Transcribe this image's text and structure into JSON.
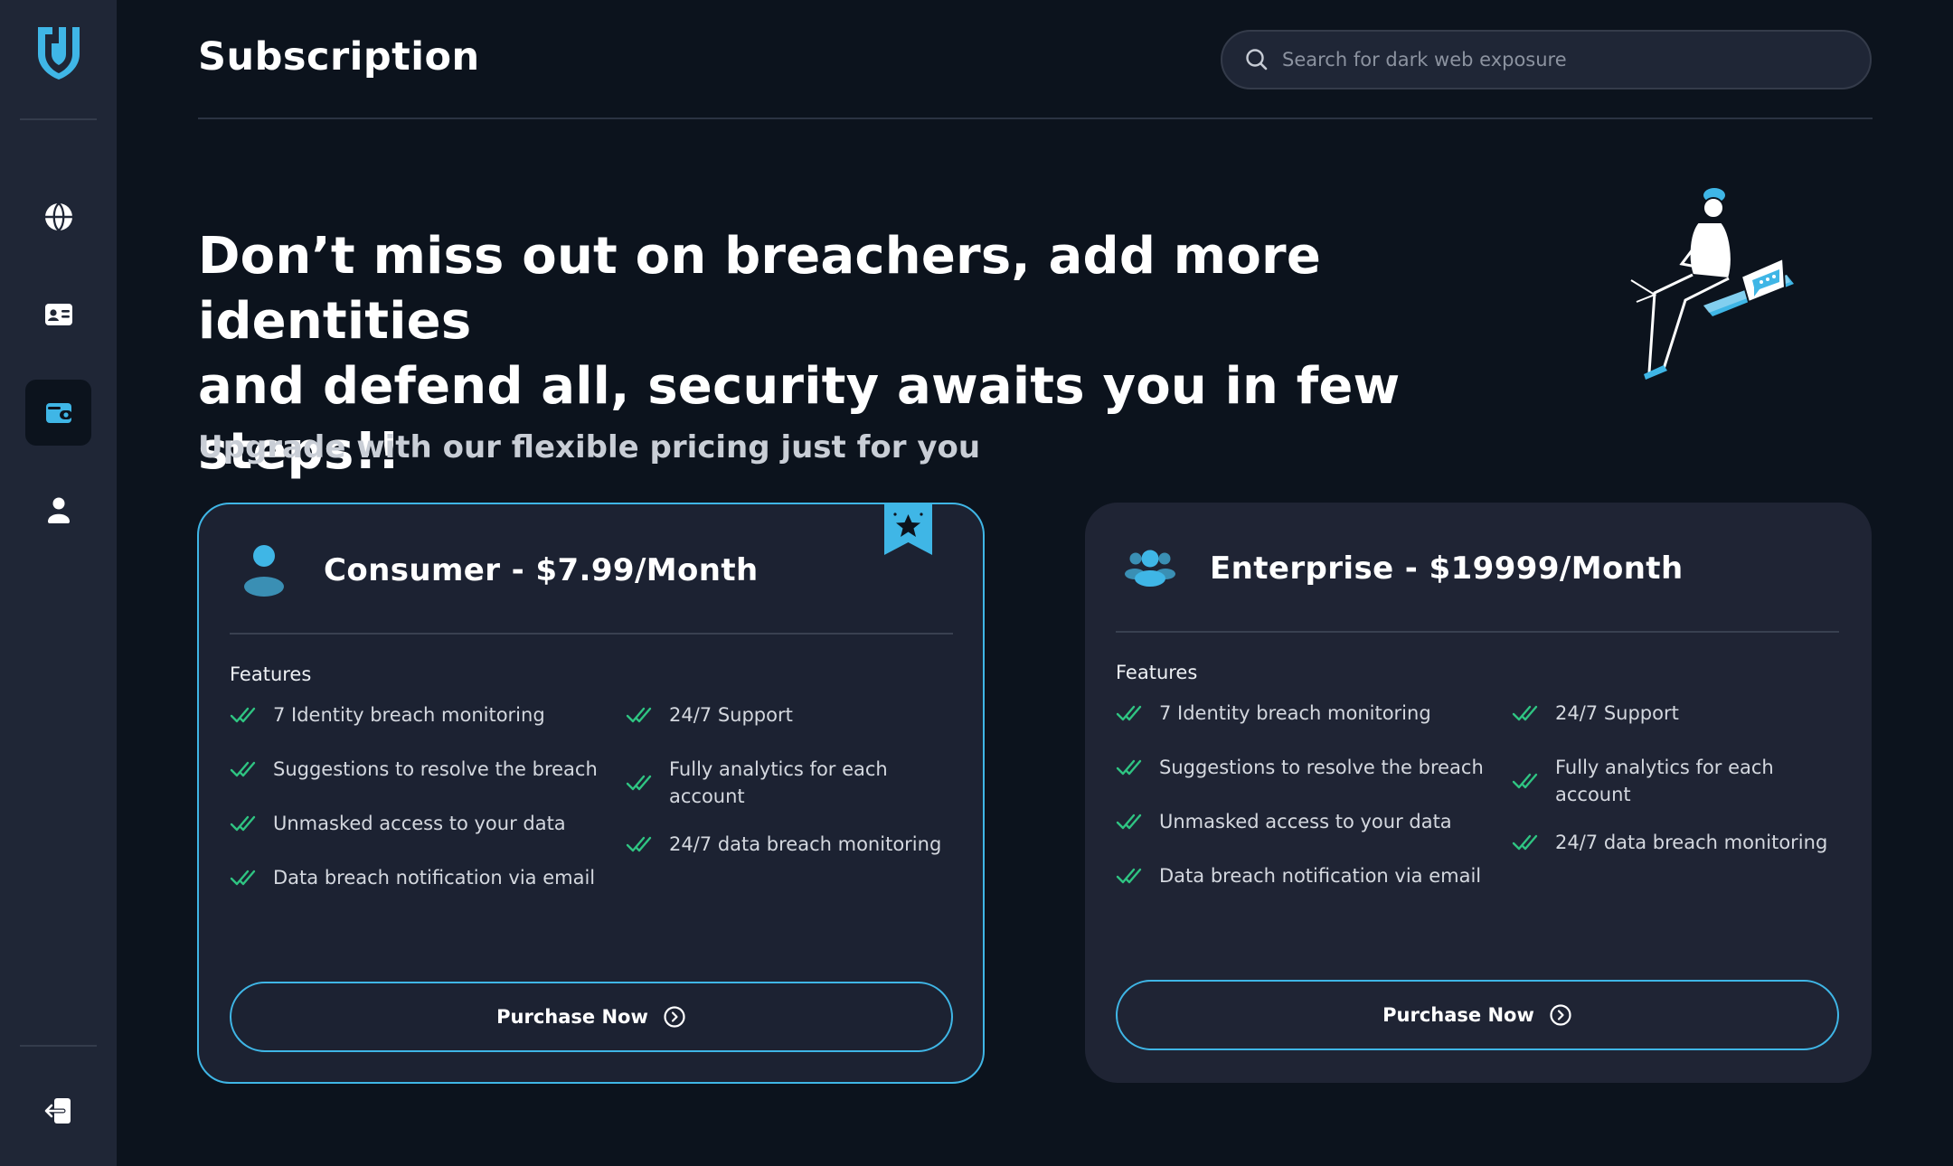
{
  "header": {
    "title": "Subscription",
    "search_placeholder": "Search for dark web exposure"
  },
  "sidebar": {
    "items": [
      {
        "icon": "globe-icon"
      },
      {
        "icon": "id-card-icon"
      },
      {
        "icon": "wallet-icon",
        "active": true
      },
      {
        "icon": "user-icon"
      }
    ],
    "footer_icon": "logout-icon"
  },
  "hero": {
    "line1": "Don’t miss out on breachers, add more identities",
    "line2": "and defend all, security awaits you in few steps!!"
  },
  "pricing_heading": "Upgrade with our flexible pricing just for you",
  "plans": [
    {
      "title": "Consumer - $7.99/Month",
      "featured": true,
      "features_label": "Features",
      "features_left": [
        "7 Identity breach monitoring",
        "Suggestions to resolve the breach",
        "Unmasked access to your data",
        "Data breach notification via email"
      ],
      "features_right": [
        "24/7 Support",
        "Fully analytics for each account",
        "24/7 data breach monitoring"
      ],
      "button": "Purchase Now"
    },
    {
      "title": "Enterprise - $19999/Month",
      "featured": false,
      "features_label": "Features",
      "features_left": [
        "7 Identity breach monitoring",
        "Suggestions to resolve the breach",
        "Unmasked access to your data",
        "Data breach notification via email"
      ],
      "features_right": [
        "24/7 Support",
        "Fully analytics for each account",
        "24/7 data breach monitoring"
      ],
      "button": "Purchase Now"
    }
  ],
  "colors": {
    "accent": "#3fb6e6",
    "check": "#2fc482",
    "background": "#0c131d",
    "sidebar": "#1f2636",
    "card": "#1f2434"
  }
}
